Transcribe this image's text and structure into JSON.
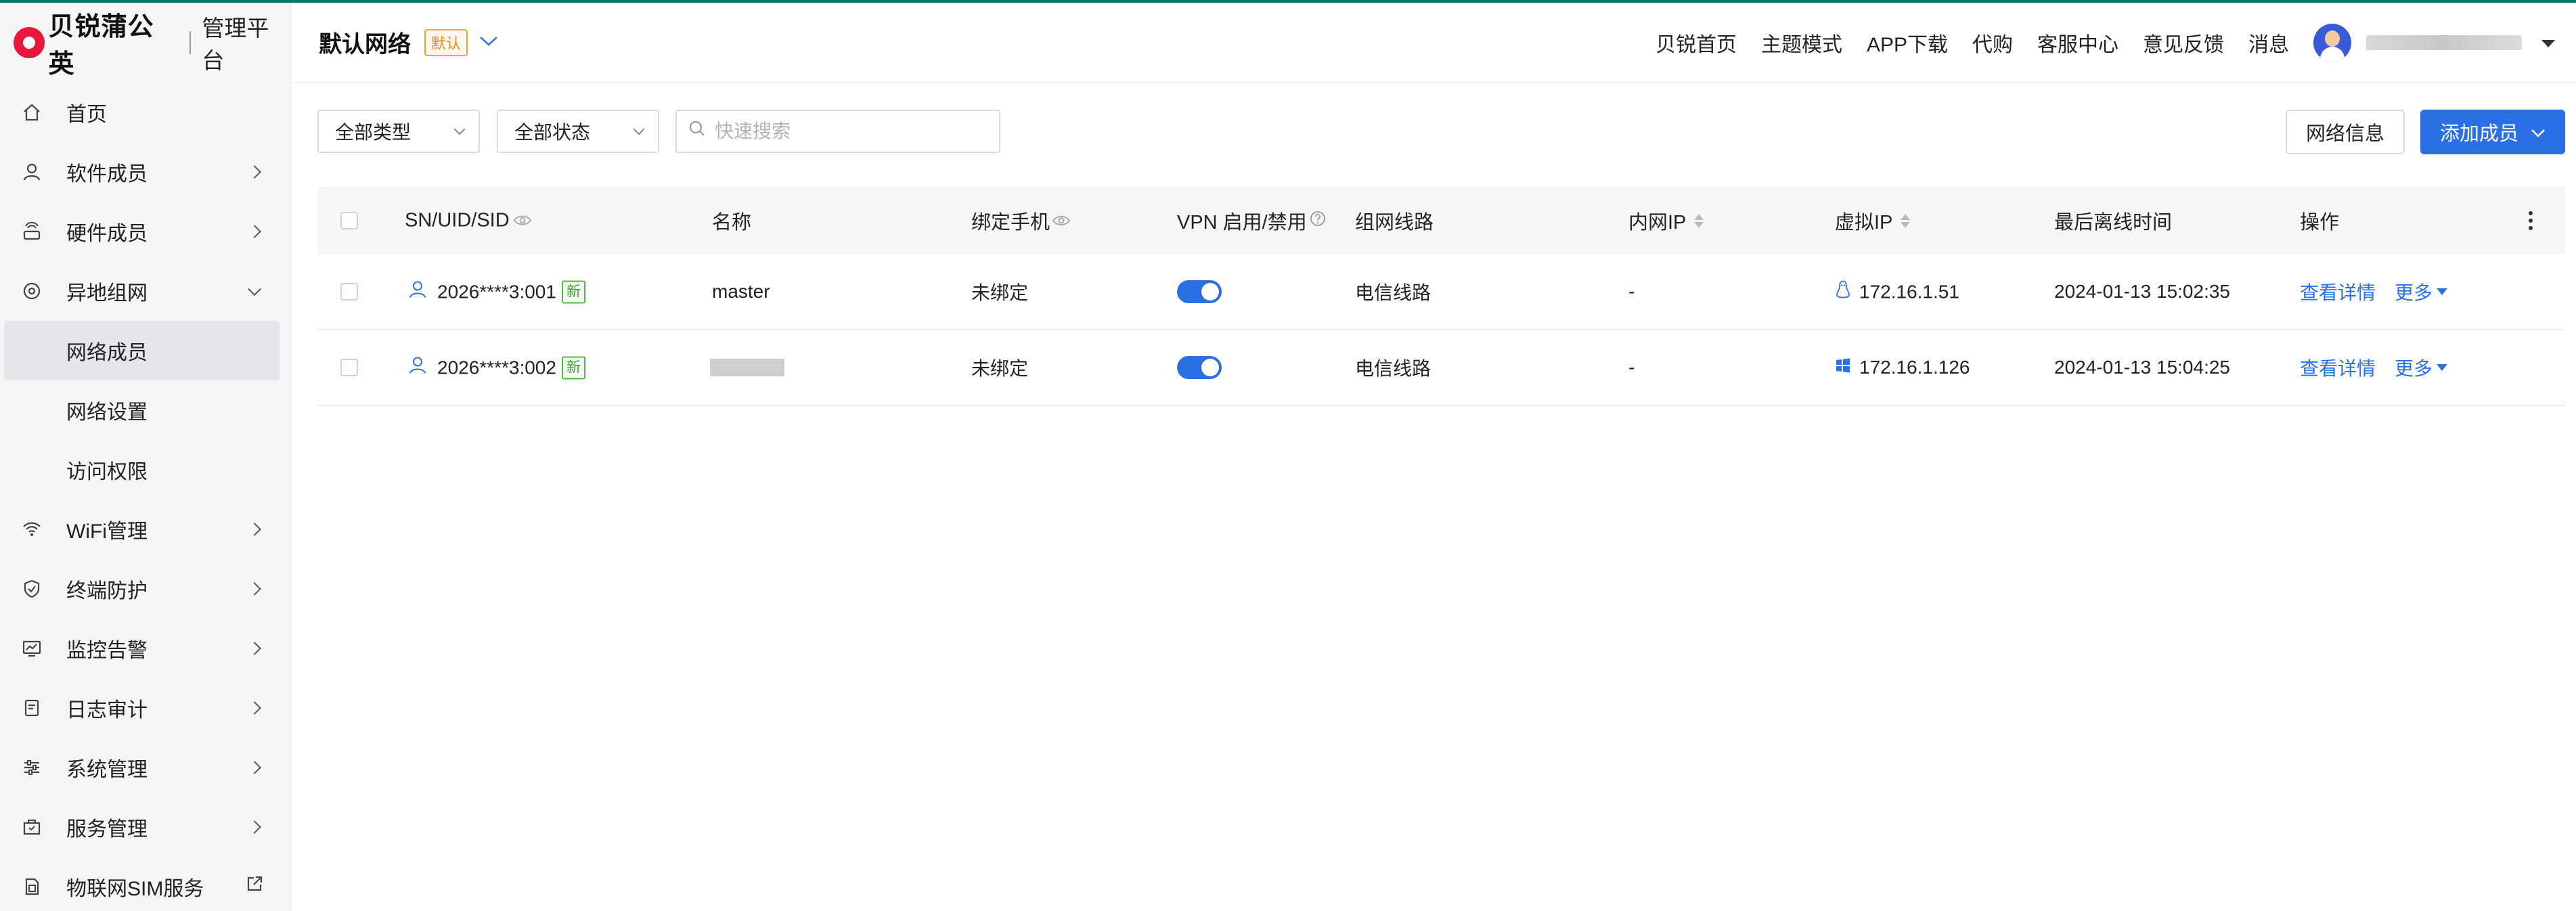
{
  "brand": {
    "name": "贝锐蒲公英",
    "subtitle": "管理平台",
    "accent": "#e8173b"
  },
  "header": {
    "network_title": "默认网络",
    "default_badge": "默认",
    "links": [
      "贝锐首页",
      "主题模式",
      "APP下载",
      "代购",
      "客服中心",
      "意见反馈",
      "消息"
    ]
  },
  "sidebar": {
    "items": [
      {
        "label": "首页",
        "icon": "home-icon"
      },
      {
        "label": "软件成员",
        "icon": "user-icon"
      },
      {
        "label": "硬件成员",
        "icon": "hardware-icon"
      },
      {
        "label": "异地组网",
        "icon": "network-icon"
      },
      {
        "label": "WiFi管理",
        "icon": "wifi-icon"
      },
      {
        "label": "终端防护",
        "icon": "shield-icon"
      },
      {
        "label": "监控告警",
        "icon": "monitor-icon"
      },
      {
        "label": "日志审计",
        "icon": "log-icon"
      },
      {
        "label": "系统管理",
        "icon": "settings-sliders-icon"
      },
      {
        "label": "服务管理",
        "icon": "service-icon"
      },
      {
        "label": "物联网SIM服务",
        "icon": "sim-icon"
      }
    ],
    "subitems": [
      "网络成员",
      "网络设置",
      "访问权限"
    ]
  },
  "toolbar": {
    "type_filter": "全部类型",
    "status_filter": "全部状态",
    "search_placeholder": "快速搜索",
    "network_info_button": "网络信息",
    "add_member_button": "添加成员"
  },
  "table": {
    "columns": {
      "sn": "SN/UID/SID",
      "name": "名称",
      "phone": "绑定手机",
      "vpn": "VPN 启用/禁用",
      "route": "组网线路",
      "lan_ip": "内网IP",
      "virtual_ip": "虚拟IP",
      "last_offline": "最后离线时间",
      "actions": "操作"
    },
    "rows": [
      {
        "sn": "2026****3:001",
        "tag": "新",
        "name": "master",
        "phone": "未绑定",
        "vpn_enabled": true,
        "route": "电信线路",
        "lan_ip": "-",
        "os": "linux-icon",
        "virtual_ip": "172.16.1.51",
        "last_offline": "2024-01-13 15:02:35",
        "detail": "查看详情",
        "more": "更多"
      },
      {
        "sn": "2026****3:002",
        "tag": "新",
        "name": "",
        "phone": "未绑定",
        "vpn_enabled": true,
        "route": "电信线路",
        "lan_ip": "-",
        "os": "windows-icon",
        "virtual_ip": "172.16.1.126",
        "last_offline": "2024-01-13 15:04:25",
        "detail": "查看详情",
        "more": "更多"
      }
    ]
  },
  "colors": {
    "primary": "#2b6fe6",
    "badge_orange": "#f08c1a",
    "tag_green": "#3e9e32"
  }
}
